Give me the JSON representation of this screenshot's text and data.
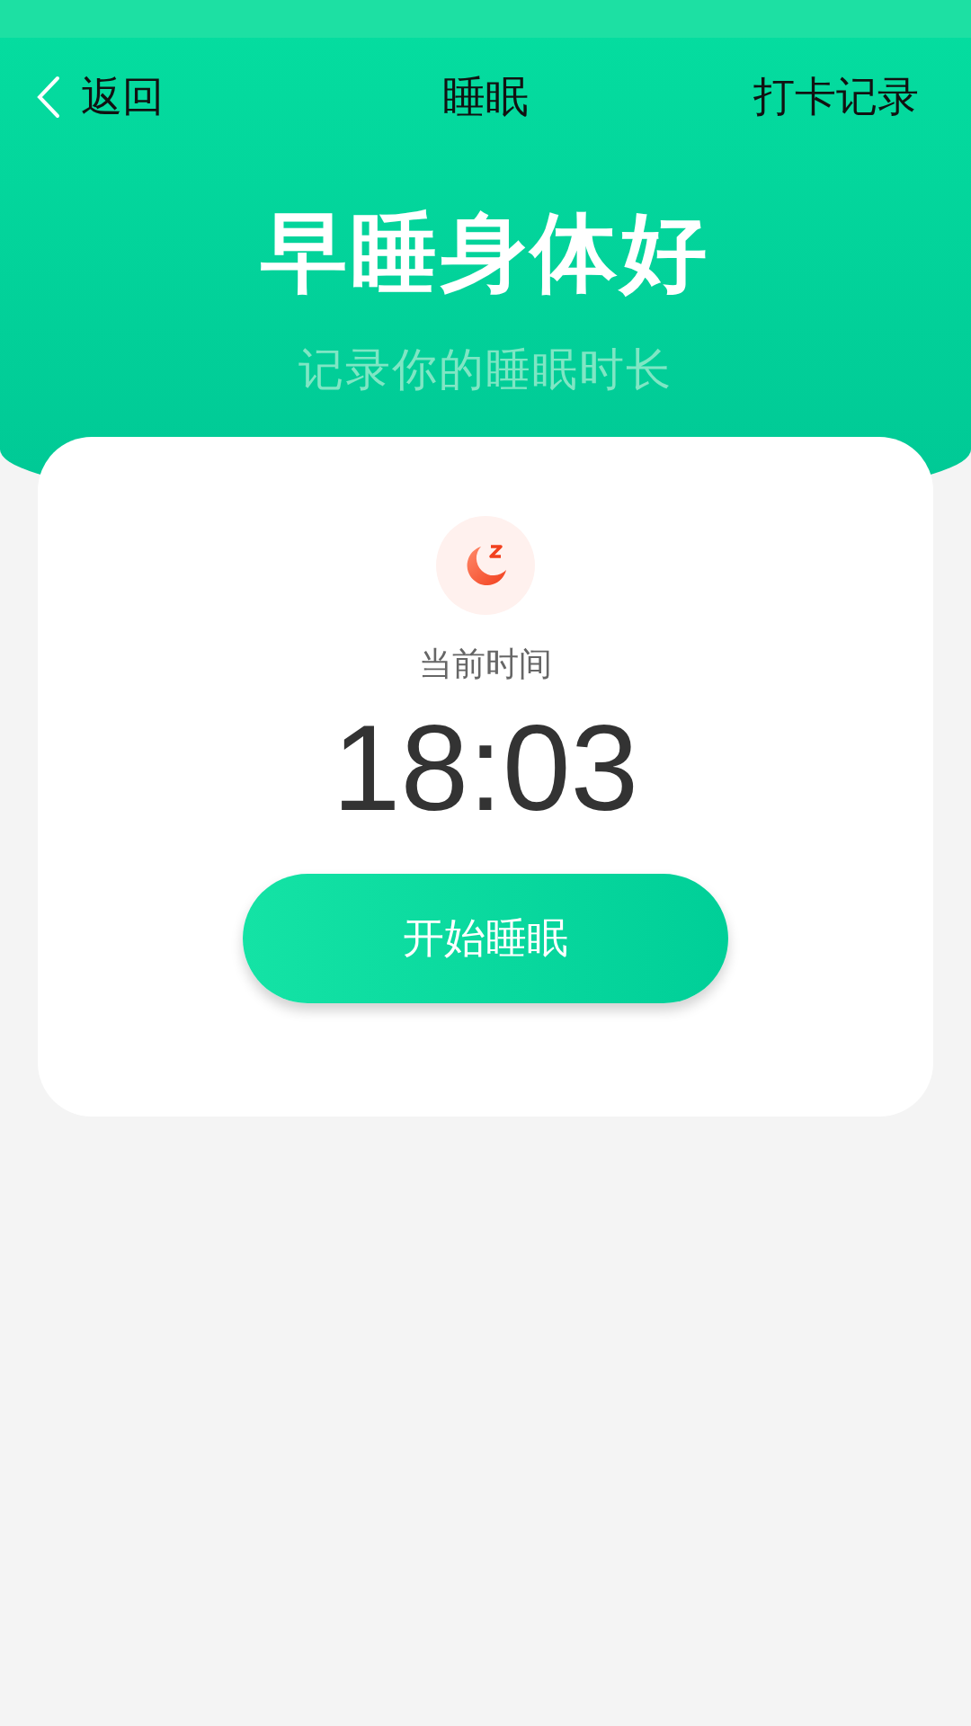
{
  "nav": {
    "back": "返回",
    "title": "睡眠",
    "action": "打卡记录"
  },
  "hero": {
    "headline": "早睡身体好",
    "subtitle": "记录你的睡眠时长"
  },
  "card": {
    "label": "当前时间",
    "time": "18:03",
    "button": "开始睡眠"
  }
}
